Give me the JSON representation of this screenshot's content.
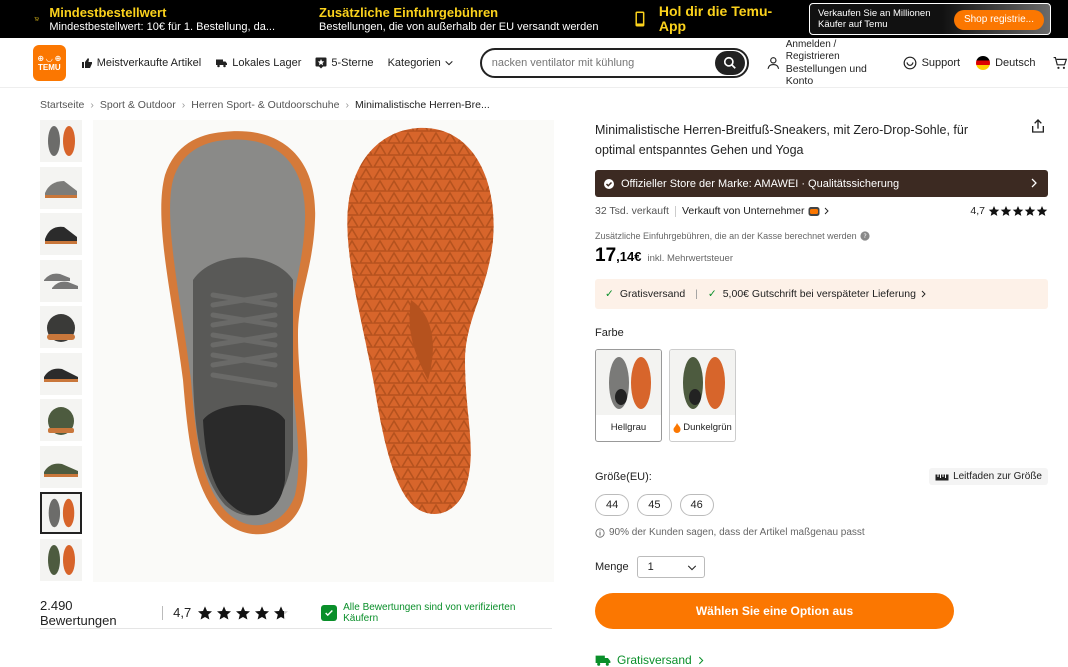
{
  "promo": {
    "item1": {
      "title": "Mindestbestellwert",
      "sub": "Mindestbestellwert: 10€ für 1. Bestellung, da..."
    },
    "item2": {
      "title": "Zusätzliche Einfuhrgebühren",
      "sub": "Bestellungen, die von außerhalb der EU versandt werden"
    },
    "item3": {
      "title": "Hol dir die Temu-App"
    },
    "seller": {
      "text": "Verkaufen Sie an Millionen Käufer auf Temu",
      "button": "Shop registrie..."
    }
  },
  "nav": {
    "logo_top": "⊕ ◡ ⊕",
    "logo_bottom": "TEMU",
    "bestsellers": "Meistverkaufte Artikel",
    "local": "Lokales Lager",
    "five_star": "5-Sterne",
    "categories": "Kategorien",
    "search_placeholder": "nacken ventilator mit kühlung",
    "account_line1": "Anmelden / Registrieren",
    "account_line2": "Bestellungen und Konto",
    "support": "Support",
    "language": "Deutsch"
  },
  "breadcrumb": [
    "Startseite",
    "Sport & Outdoor",
    "Herren Sport- & Outdoorschuhe",
    "Minimalistische Herren-Bre..."
  ],
  "reviews": {
    "count": "2.490 Bewertungen",
    "avg": "4,7",
    "verified": "Alle Bewertungen sind von verifizierten Käufern"
  },
  "product": {
    "title": "Minimalistische Herren-Breitfuß-Sneakers, mit Zero-Drop-Sohle, für optimal entspanntes Gehen und Yoga",
    "store": "Offizieller Store der Marke: AMAWEI · Qualitätssicherung",
    "sold": "32 Tsd. verkauft",
    "seller": "Verkauft von Unternehmer",
    "rating": "4,7",
    "fee_note": "Zusätzliche Einfuhrgebühren, die an der Kasse berechnet werden",
    "price_main": "17",
    "price_rest": ",14€",
    "tax": "inkl. Mehrwertsteuer",
    "ship1": "Gratisversand",
    "ship2": "5,00€ Gutschrift bei verspäteter Lieferung",
    "color_label": "Farbe",
    "colors": [
      "Hellgrau",
      "Dunkelgrün"
    ],
    "size_label": "Größe(EU):",
    "size_guide": "Leitfaden zur Größe",
    "sizes": [
      "44",
      "45",
      "46"
    ],
    "fit_note": "90% der Kunden sagen, dass der Artikel maßgenau passt",
    "qty_label": "Menge",
    "qty_value": "1",
    "cta": "Wählen Sie eine Option aus",
    "free_ship": "Gratisversand"
  },
  "colors": {
    "accent": "#fb7701",
    "promo_yellow": "#fbd21c",
    "green": "#0a8f2a",
    "store_bar": "#3c2a22"
  }
}
